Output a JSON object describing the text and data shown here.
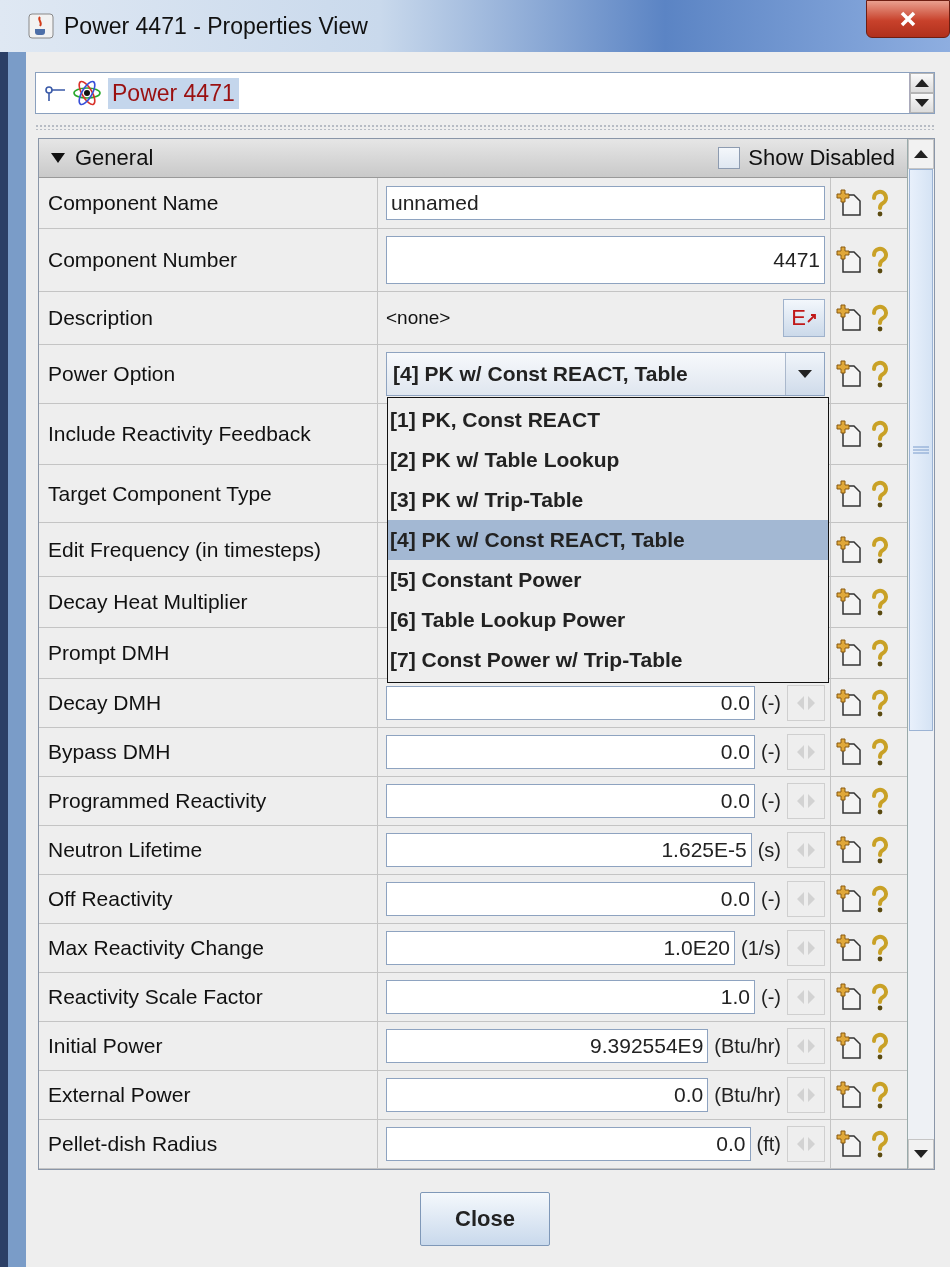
{
  "window": {
    "title": "Power 4471 - Properties View"
  },
  "tree_path": {
    "label": "Power 4471",
    "selected": true
  },
  "section": {
    "title": "General",
    "expanded": true,
    "show_disabled": {
      "label": "Show Disabled",
      "checked": false
    }
  },
  "rows": [
    {
      "kind": "text",
      "label": "Component Name",
      "value": "unnamed"
    },
    {
      "kind": "number",
      "label": "Component Number",
      "value": "4471"
    },
    {
      "kind": "description",
      "label": "Description",
      "value": "<none>",
      "button": "E"
    },
    {
      "kind": "combo",
      "label": "Power Option",
      "value": "[4] PK w/ Const REACT, Table"
    },
    {
      "kind": "covered",
      "label": "Include Reactivity Feedback"
    },
    {
      "kind": "covered",
      "label": "Target Component Type"
    },
    {
      "kind": "covered",
      "label": "Edit Frequency (in timesteps)"
    },
    {
      "kind": "covered",
      "label": "Decay Heat Multiplier"
    },
    {
      "kind": "covered",
      "label": "Prompt DMH"
    },
    {
      "kind": "unit",
      "label": "Decay DMH",
      "value": "0.0",
      "unit": "(-)"
    },
    {
      "kind": "unit",
      "label": "Bypass DMH",
      "value": "0.0",
      "unit": "(-)"
    },
    {
      "kind": "unit",
      "label": "Programmed Reactivity",
      "value": "0.0",
      "unit": "(-)"
    },
    {
      "kind": "unit",
      "label": "Neutron Lifetime",
      "value": "1.625E-5",
      "unit": "(s)"
    },
    {
      "kind": "unit",
      "label": "Off Reactivity",
      "value": "0.0",
      "unit": "(-)"
    },
    {
      "kind": "unit",
      "label": "Max Reactivity Change",
      "value": "1.0E20",
      "unit": "(1/s)"
    },
    {
      "kind": "unit",
      "label": "Reactivity Scale Factor",
      "value": "1.0",
      "unit": "(-)"
    },
    {
      "kind": "unit",
      "label": "Initial Power",
      "value": "9.392554E9",
      "unit": "(Btu/hr)"
    },
    {
      "kind": "unit",
      "label": "External Power",
      "value": "0.0",
      "unit": "(Btu/hr)"
    },
    {
      "kind": "unit",
      "label": "Pellet-dish Radius",
      "value": "0.0",
      "unit": "(ft)"
    }
  ],
  "dropdown_options": [
    {
      "label": "[1] PK, Const REACT",
      "selected": false
    },
    {
      "label": "[2] PK w/ Table Lookup",
      "selected": false
    },
    {
      "label": "[3] PK w/ Trip-Table",
      "selected": false
    },
    {
      "label": "[4] PK w/ Const REACT, Table",
      "selected": true
    },
    {
      "label": "[5] Constant Power",
      "selected": false
    },
    {
      "label": "[6] Table Lookup Power",
      "selected": false
    },
    {
      "label": "[7] Const Power w/ Trip-Table",
      "selected": false
    }
  ],
  "close_button": "Close"
}
